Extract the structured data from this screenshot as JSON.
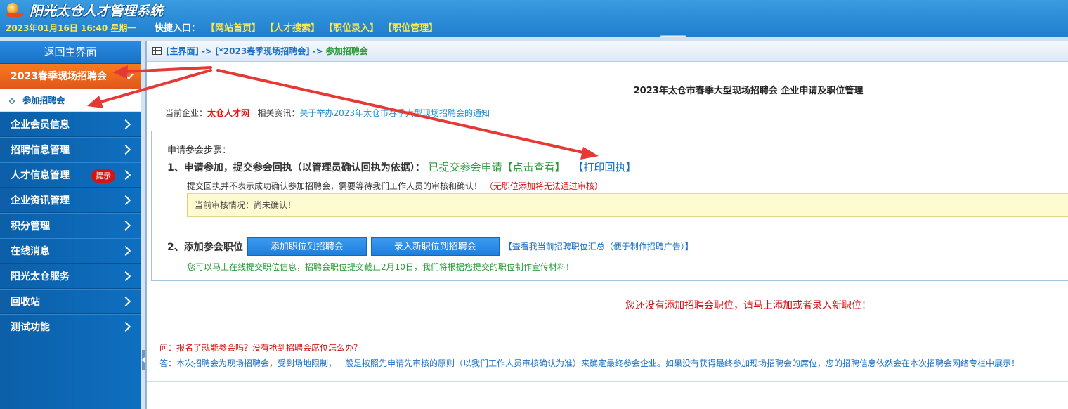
{
  "header": {
    "app_title": "阳光太仓人才管理系统",
    "datetime": "2023年01月16日 16:40 星期一",
    "quick_label": "快捷入口：",
    "quick_links": [
      "【网站首页】",
      "【人才搜索】",
      "【职位录入】",
      "【职位管理】"
    ]
  },
  "sidebar": {
    "home": "返回主界面",
    "active_group": "2023春季现场招聘会",
    "active_sub": "参加招聘会",
    "items": [
      {
        "label": "企业会员信息"
      },
      {
        "label": "招聘信息管理"
      },
      {
        "label": "人才信息管理",
        "badge": "提示"
      },
      {
        "label": "企业资讯管理"
      },
      {
        "label": "积分管理"
      },
      {
        "label": "在线消息"
      },
      {
        "label": "阳光太仓服务"
      },
      {
        "label": "回收站"
      },
      {
        "label": "测试功能"
      }
    ]
  },
  "breadcrumb": {
    "home": "[主界面]",
    "sep": "->",
    "section": "[*2023春季现场招聘会]",
    "current": "参加招聘会"
  },
  "main": {
    "title": "2023年太仓市春季大型现场招聘会 企业申请及职位管理",
    "company_label": "当前企业：",
    "company_name": "太仓人才网",
    "info_label": "相关资讯：",
    "info_link": "关于举办2023年太仓市春季大型现场招聘会的通知",
    "steps_title": "申请参会步骤：",
    "step1_label": "1、申请参加，提交参会回执（以管理员确认回执为依据）：",
    "step1_status": "已提交参会申请【点击查看】",
    "step1_print": "【打印回执】",
    "step1_note": "提交回执并不表示成功确认参加招聘会，需要等待我们工作人员的审核和确认！",
    "step1_warning": "（无职位添加将无法通过审核）",
    "review_status": "当前审核情况：尚未确认！",
    "step2_label": "2、添加参会职位",
    "btn_add": "添加职位到招聘会",
    "btn_new": "录入新职位到招聘会",
    "summary_link": "【查看我当前招聘职位汇总（便于制作招聘广告）】",
    "step2_note": "您可以马上在线提交职位信息，招聘会职位提交截止2月10日，我们将根据您提交的职位制作宣传材料！",
    "no_positions": "您还没有添加招聘会职位，请马上添加或者录入新职位！",
    "faq_q": "问：报名了就能参会吗？没有抢到招聘会席位怎么办？",
    "faq_a": "答：本次招聘会为现场招聘会，受到场地限制，一般是按照先申请先审核的原则（以我们工作人员审核确认为准）来确定最终参会企业。如果没有获得最终参加现场招聘会的席位，您的招聘信息依然会在本次招聘会网络专栏中展示！"
  },
  "colors": {
    "header_blue": "#1f7fcf",
    "sidebar_blue": "#0e6fc0",
    "active_orange": "#f97a1f",
    "link_yellow": "#ffe84a",
    "annotation_red": "#e53935",
    "status_green": "#2a9a3a"
  }
}
